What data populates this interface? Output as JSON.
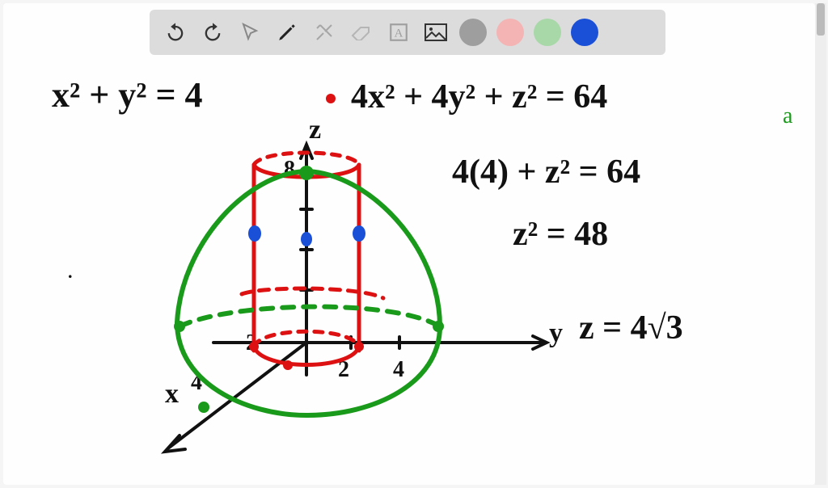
{
  "toolbar": {
    "undo": "↺",
    "redo": "↻",
    "pointer": "↖",
    "pen": "✎",
    "tools": "✕",
    "eraser": "▱",
    "text": "A",
    "image": "🖼",
    "colors": {
      "gray": "#9e9e9e",
      "pink": "#f4b4b4",
      "green": "#a8d8a8",
      "blue": "#1a4fd8"
    }
  },
  "equations": {
    "cylinder": "x² + y² = 4",
    "ellipsoid": "4x² + 4y² + z² = 64",
    "sub": "4(4) + z² = 64",
    "zsq": "z² = 48",
    "zroot": "z = 4√3"
  },
  "axes": {
    "x": "x",
    "y": "y",
    "z": "z",
    "ticks": {
      "two": "2",
      "four": "4",
      "eight": "8"
    },
    "xlabel": "4"
  },
  "dot": "."
}
